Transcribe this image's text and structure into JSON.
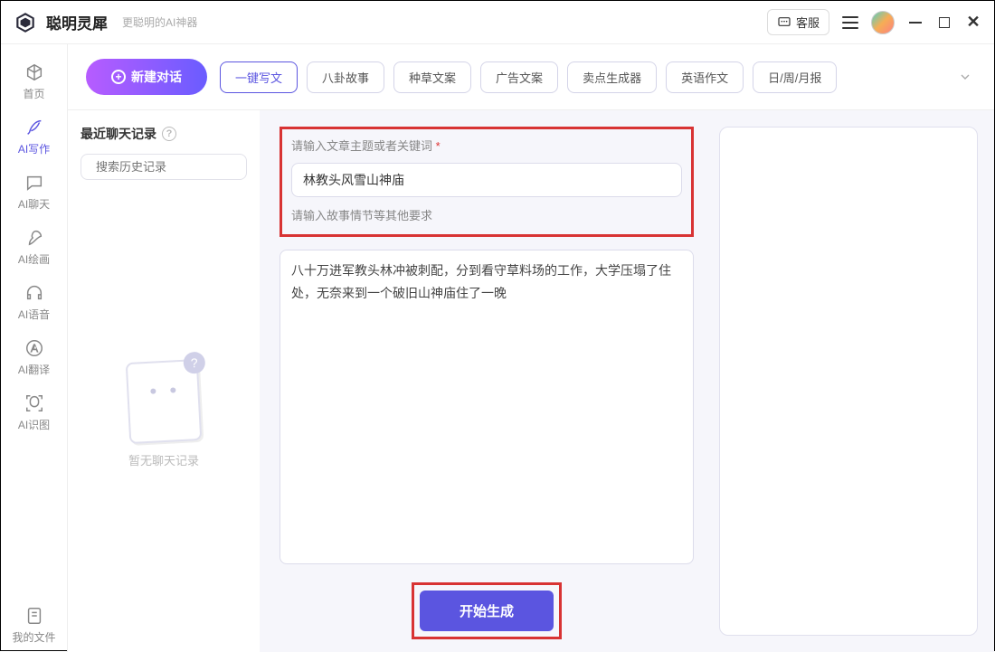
{
  "titlebar": {
    "app_name": "聪明灵犀",
    "app_subtitle": "更聪明的AI神器",
    "customer_service": "客服"
  },
  "sidebar": {
    "items": [
      {
        "label": "首页"
      },
      {
        "label": "AI写作"
      },
      {
        "label": "AI聊天"
      },
      {
        "label": "AI绘画"
      },
      {
        "label": "AI语音"
      },
      {
        "label": "AI翻译"
      },
      {
        "label": "AI识图"
      }
    ],
    "footer_label": "我的文件"
  },
  "toolbar": {
    "new_chat_label": "新建对话",
    "tabs": [
      "一键写文",
      "八卦故事",
      "种草文案",
      "广告文案",
      "卖点生成器",
      "英语作文",
      "日/周/月报"
    ]
  },
  "history": {
    "title": "最近聊天记录",
    "search_placeholder": "搜索历史记录",
    "empty_label": "暂无聊天记录"
  },
  "form": {
    "topic_label": "请输入文章主题或者关键词",
    "topic_value": "林教头风雪山神庙",
    "detail_label": "请输入故事情节等其他要求",
    "detail_value": "八十万进军教头林冲被刺配，分到看守草料场的工作，大学压塌了住处，无奈来到一个破旧山神庙住了一晚",
    "generate_label": "开始生成"
  }
}
